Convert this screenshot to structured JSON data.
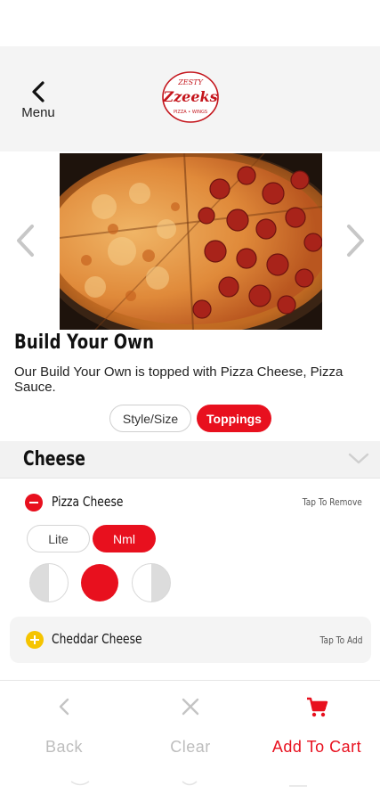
{
  "header": {
    "back_label": "Menu",
    "logo_top": "ZESTY",
    "logo_main": "Zzeeks",
    "logo_bottom": "PIZZA • WINGS"
  },
  "product": {
    "title": "Build Your Own",
    "description": "Our Build Your Own is topped with Pizza Cheese, Pizza Sauce."
  },
  "tabs": [
    {
      "label": "Style/Size",
      "active": false
    },
    {
      "label": "Toppings",
      "active": true
    }
  ],
  "section": {
    "title": "Cheese"
  },
  "items": [
    {
      "name": "Pizza Cheese",
      "hint": "Tap To Remove",
      "selected": true
    },
    {
      "name": "Cheddar Cheese",
      "hint": "Tap To Add",
      "selected": false
    }
  ],
  "amounts": [
    {
      "label": "Lite",
      "active": false
    },
    {
      "label": "Nml",
      "active": true
    }
  ],
  "portions": [
    "left-half",
    "whole",
    "right-half"
  ],
  "bottom": {
    "back_label": "Back",
    "clear_label": "Clear",
    "cart_label": "Add To Cart"
  },
  "colors": {
    "accent": "#e8101e",
    "add": "#f5c400",
    "muted": "#bdbdbd"
  }
}
